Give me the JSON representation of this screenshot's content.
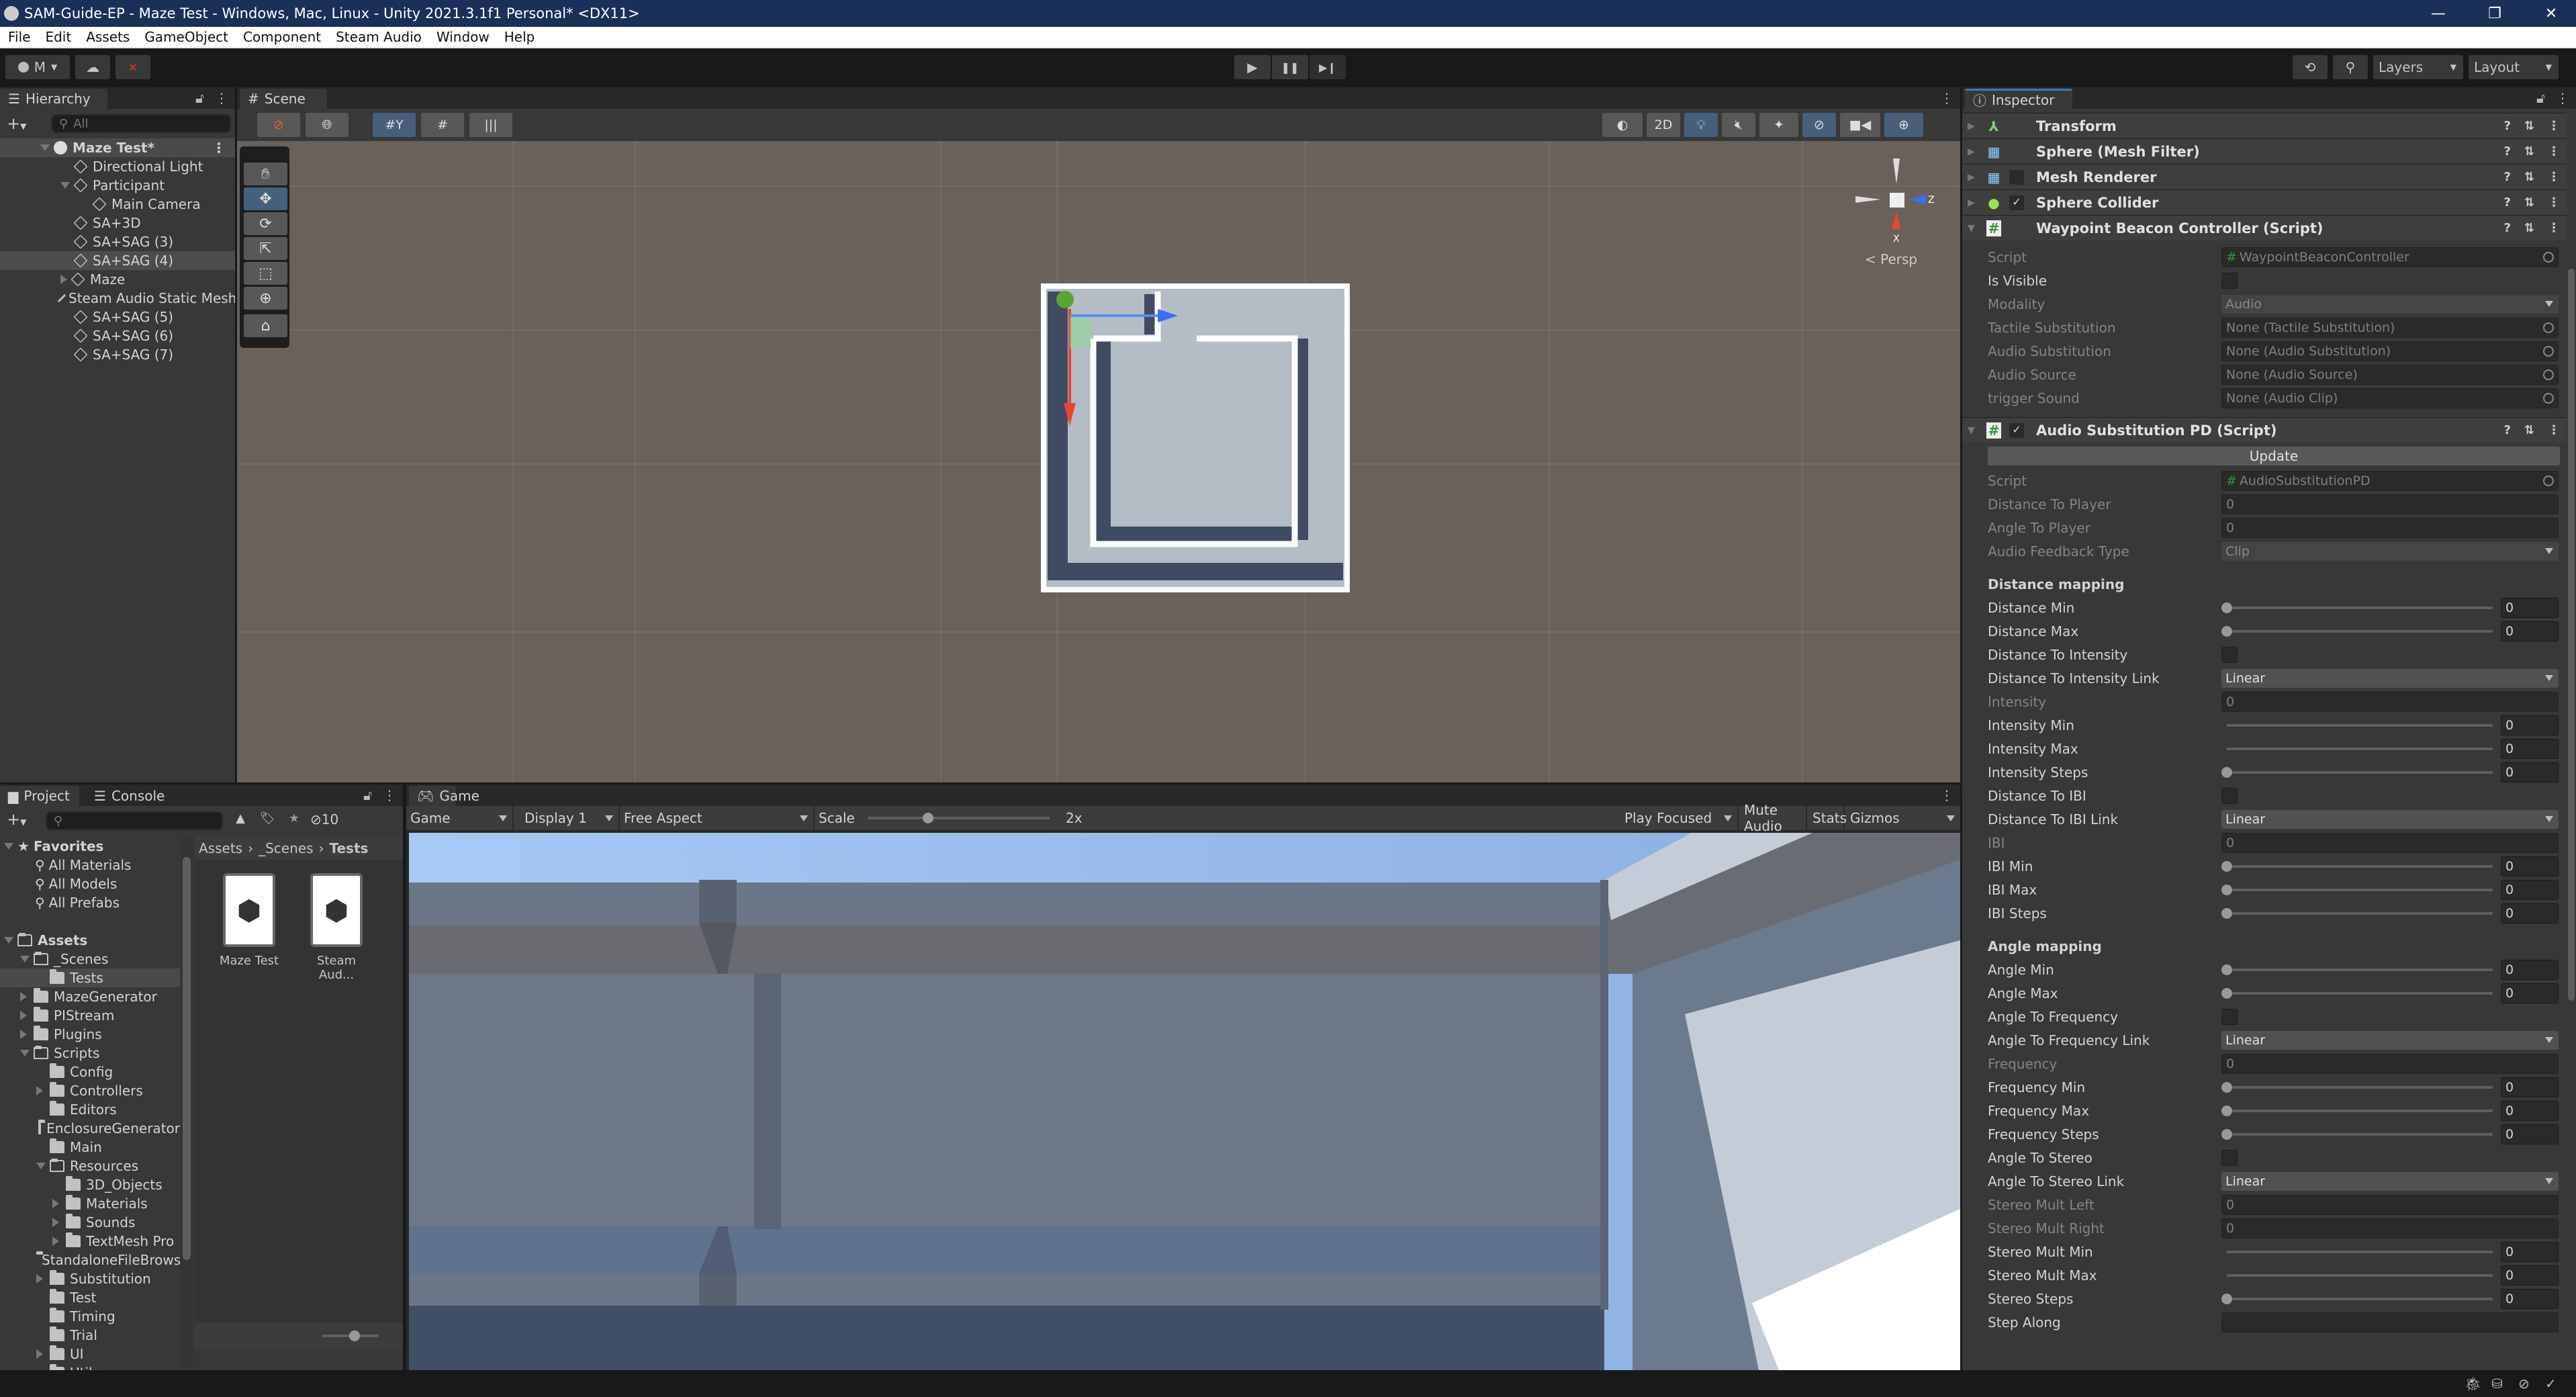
{
  "window": {
    "title": "SAM-Guide-EP - Maze Test - Windows, Mac, Linux - Unity 2021.3.1f1 Personal* <DX11>",
    "controls": {
      "minimize": "—",
      "maximize": "❐",
      "close": "✕"
    }
  },
  "menu": [
    "File",
    "Edit",
    "Assets",
    "GameObject",
    "Component",
    "Steam Audio",
    "Window",
    "Help"
  ],
  "toolbar": {
    "account_label": "M",
    "play_icon": "▶",
    "pause_icon": "❚❚",
    "step_icon": "▶❙",
    "history_icon": "⟲",
    "search_icon": "⚲",
    "layers_label": "Layers",
    "layout_label": "Layout"
  },
  "hierarchy": {
    "tab_label": "Hierarchy",
    "search_placeholder": "All",
    "scene_name": "Maze Test*",
    "items": [
      {
        "label": "Directional Light",
        "indent": 1,
        "expander": "none"
      },
      {
        "label": "Participant",
        "indent": 1,
        "expander": "expanded"
      },
      {
        "label": "Main Camera",
        "indent": 2,
        "expander": "none"
      },
      {
        "label": "SA+3D",
        "indent": 1,
        "expander": "none"
      },
      {
        "label": "SA+SAG (3)",
        "indent": 1,
        "expander": "none"
      },
      {
        "label": "SA+SAG (4)",
        "indent": 1,
        "expander": "none",
        "selected": true
      },
      {
        "label": "Maze",
        "indent": 1,
        "expander": "collapsed"
      },
      {
        "label": "Steam Audio Static Mesh",
        "indent": 1,
        "expander": "none"
      },
      {
        "label": "SA+SAG (5)",
        "indent": 1,
        "expander": "none"
      },
      {
        "label": "SA+SAG (6)",
        "indent": 1,
        "expander": "none"
      },
      {
        "label": "SA+SAG (7)",
        "indent": 1,
        "expander": "none"
      }
    ]
  },
  "scene": {
    "tab_label": "Scene",
    "toggle_2d": "2D",
    "persp_label": "Persp",
    "axis_x": "X",
    "axis_z": "Z"
  },
  "inspector": {
    "tab_label": "Inspector",
    "components": [
      {
        "name": "Transform",
        "icon": "transform-icon"
      },
      {
        "name": "Sphere (Mesh Filter)",
        "icon": "mesh-filter-icon"
      },
      {
        "name": "Mesh Renderer",
        "icon": "mesh-renderer-icon",
        "enabled": false
      },
      {
        "name": "Sphere Collider",
        "icon": "sphere-collider-icon",
        "enabled": true
      },
      {
        "name": "Waypoint Beacon Controller (Script)",
        "icon": "script-icon",
        "expanded": true
      }
    ],
    "waypoint_props": [
      {
        "label": "Script",
        "type": "object",
        "value": "WaypointBeaconController",
        "disabled": true
      },
      {
        "label": "Is Visible",
        "type": "checkbox",
        "checked": false
      },
      {
        "label": "Modality",
        "type": "dropdown",
        "value": "Audio",
        "disabled": true
      },
      {
        "label": "Tactile Substitution",
        "type": "object",
        "value": "None (Tactile Substitution)",
        "disabled": true
      },
      {
        "label": "Audio Substitution",
        "type": "object",
        "value": "None (Audio Substitution)",
        "disabled": true
      },
      {
        "label": "Audio Source",
        "type": "object",
        "value": "None (Audio Source)",
        "disabled": true
      },
      {
        "label": "trigger Sound",
        "type": "object",
        "value": "None (Audio Clip)",
        "disabled": true
      }
    ],
    "audio_component": {
      "name": "Audio Substitution PD (Script)",
      "enabled": true,
      "update_button": "Update"
    },
    "audio_props": [
      {
        "label": "Script",
        "type": "object",
        "value": "AudioSubstitutionPD",
        "disabled": true
      },
      {
        "label": "Distance To Player",
        "type": "text",
        "value": "0",
        "disabled": true
      },
      {
        "label": "Angle To Player",
        "type": "text",
        "value": "0",
        "disabled": true
      },
      {
        "label": "Audio Feedback Type",
        "type": "dropdown",
        "value": "Clip",
        "disabled": true
      },
      {
        "type": "spacer"
      },
      {
        "label": "Distance mapping",
        "type": "section"
      },
      {
        "label": "Distance Min",
        "type": "slider",
        "value": "0",
        "knob": true
      },
      {
        "label": "Distance Max",
        "type": "slider",
        "value": "0",
        "knob": true
      },
      {
        "label": "Distance To Intensity",
        "type": "checkbox",
        "checked": false
      },
      {
        "label": "Distance To Intensity Link",
        "type": "dropdown",
        "value": "Linear"
      },
      {
        "label": "Intensity",
        "type": "text",
        "value": "0",
        "disabled": true
      },
      {
        "label": "Intensity Min",
        "type": "slider",
        "value": "0",
        "knob": false
      },
      {
        "label": "Intensity Max",
        "type": "slider",
        "value": "0",
        "knob": false
      },
      {
        "label": "Intensity Steps",
        "type": "slider",
        "value": "0",
        "knob": true
      },
      {
        "label": "Distance To IBI",
        "type": "checkbox",
        "checked": false
      },
      {
        "label": "Distance To IBI Link",
        "type": "dropdown",
        "value": "Linear"
      },
      {
        "label": "IBI",
        "type": "text",
        "value": "0",
        "disabled": true
      },
      {
        "label": "IBI Min",
        "type": "slider",
        "value": "0",
        "knob": true
      },
      {
        "label": "IBI Max",
        "type": "slider",
        "value": "0",
        "knob": true
      },
      {
        "label": "IBI Steps",
        "type": "slider",
        "value": "0",
        "knob": true
      },
      {
        "type": "spacer"
      },
      {
        "label": "Angle mapping",
        "type": "section"
      },
      {
        "label": "Angle Min",
        "type": "slider",
        "value": "0",
        "knob": true
      },
      {
        "label": "Angle Max",
        "type": "slider",
        "value": "0",
        "knob": true
      },
      {
        "label": "Angle To Frequency",
        "type": "checkbox",
        "checked": false
      },
      {
        "label": "Angle To Frequency Link",
        "type": "dropdown",
        "value": "Linear"
      },
      {
        "label": "Frequency",
        "type": "text",
        "value": "0",
        "disabled": true
      },
      {
        "label": "Frequency Min",
        "type": "slider",
        "value": "0",
        "knob": true
      },
      {
        "label": "Frequency Max",
        "type": "slider",
        "value": "0",
        "knob": true
      },
      {
        "label": "Frequency Steps",
        "type": "slider",
        "value": "0",
        "knob": true
      },
      {
        "label": "Angle To Stereo",
        "type": "checkbox",
        "checked": false
      },
      {
        "label": "Angle To Stereo Link",
        "type": "dropdown",
        "value": "Linear"
      },
      {
        "label": "Stereo Mult Left",
        "type": "text",
        "value": "0",
        "disabled": true
      },
      {
        "label": "Stereo Mult Right",
        "type": "text",
        "value": "0",
        "disabled": true
      },
      {
        "label": "Stereo Mult Min",
        "type": "slider",
        "value": "0",
        "knob": false
      },
      {
        "label": "Stereo Mult Max",
        "type": "slider",
        "value": "0",
        "knob": false
      },
      {
        "label": "Stereo Steps",
        "type": "slider",
        "value": "0",
        "knob": true
      },
      {
        "label": "Step Along",
        "type": "text",
        "value": ""
      }
    ]
  },
  "project": {
    "tab_project": "Project",
    "tab_console": "Console",
    "hidden_count": "10",
    "breadcrumb": [
      "Assets",
      "_Scenes",
      "Tests"
    ],
    "favorites_label": "Favorites",
    "favorites": [
      "All Materials",
      "All Models",
      "All Prefabs"
    ],
    "tree": [
      {
        "label": "Assets",
        "indent": 0,
        "expander": "expanded",
        "bold": true,
        "open": true
      },
      {
        "label": "_Scenes",
        "indent": 1,
        "expander": "expanded",
        "open": true
      },
      {
        "label": "Tests",
        "indent": 2,
        "expander": "none",
        "selected": true
      },
      {
        "label": "MazeGenerator",
        "indent": 1,
        "expander": "collapsed"
      },
      {
        "label": "PIStream",
        "indent": 1,
        "expander": "collapsed"
      },
      {
        "label": "Plugins",
        "indent": 1,
        "expander": "collapsed"
      },
      {
        "label": "Scripts",
        "indent": 1,
        "expander": "expanded",
        "open": true
      },
      {
        "label": "Config",
        "indent": 2,
        "expander": "none"
      },
      {
        "label": "Controllers",
        "indent": 2,
        "expander": "collapsed"
      },
      {
        "label": "Editors",
        "indent": 2,
        "expander": "none"
      },
      {
        "label": "EnclosureGenerator",
        "indent": 2,
        "expander": "none"
      },
      {
        "label": "Main",
        "indent": 2,
        "expander": "none"
      },
      {
        "label": "Resources",
        "indent": 2,
        "expander": "expanded",
        "open": true
      },
      {
        "label": "3D_Objects",
        "indent": 3,
        "expander": "none"
      },
      {
        "label": "Materials",
        "indent": 3,
        "expander": "collapsed"
      },
      {
        "label": "Sounds",
        "indent": 3,
        "expander": "collapsed"
      },
      {
        "label": "TextMesh Pro",
        "indent": 3,
        "expander": "collapsed"
      },
      {
        "label": "StandaloneFileBrowser",
        "indent": 2,
        "expander": "none"
      },
      {
        "label": "Substitution",
        "indent": 2,
        "expander": "collapsed"
      },
      {
        "label": "Test",
        "indent": 2,
        "expander": "none"
      },
      {
        "label": "Timing",
        "indent": 2,
        "expander": "none"
      },
      {
        "label": "Trial",
        "indent": 2,
        "expander": "none"
      },
      {
        "label": "UI",
        "indent": 2,
        "expander": "collapsed"
      },
      {
        "label": "Utils",
        "indent": 2,
        "expander": "none"
      }
    ],
    "assets": [
      "Maze Test",
      "Steam Aud..."
    ]
  },
  "game": {
    "tab_label": "Game",
    "view_mode": "Game",
    "display": "Display 1",
    "aspect": "Free Aspect",
    "scale_label": "Scale",
    "scale_value": "2x",
    "scale_fraction": 0.33,
    "play_mode": "Play Focused",
    "mute_audio": "Mute Audio",
    "stats": "Stats",
    "gizmos": "Gizmos"
  }
}
